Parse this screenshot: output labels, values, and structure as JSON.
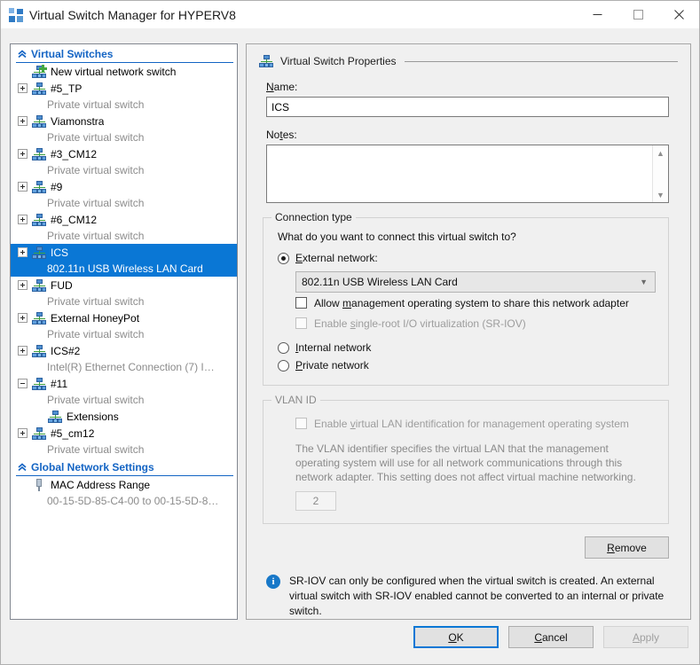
{
  "window": {
    "title": "Virtual Switch Manager for HYPERV8",
    "icon": "virtual-switch-manager-icon",
    "minimize_label": "–",
    "maximize_label": "□",
    "close_label": "✕"
  },
  "tree": {
    "sections": [
      {
        "id": "virtual-switches",
        "label": "Virtual Switches",
        "chevron": "chevron-up-icon",
        "items": [
          {
            "label": "New virtual network switch",
            "sub": "",
            "icon": "new-virtual-switch-icon",
            "expander": "none",
            "selected": false,
            "indent": 0
          },
          {
            "label": "#5_TP",
            "sub": "Private virtual switch",
            "icon": "virtual-switch-icon",
            "expander": "plus",
            "selected": false,
            "indent": 0
          },
          {
            "label": "Viamonstra",
            "sub": "Private virtual switch",
            "icon": "virtual-switch-icon",
            "expander": "plus",
            "selected": false,
            "indent": 0
          },
          {
            "label": "#3_CM12",
            "sub": "Private virtual switch",
            "icon": "virtual-switch-icon",
            "expander": "plus",
            "selected": false,
            "indent": 0
          },
          {
            "label": "#9",
            "sub": "Private virtual switch",
            "icon": "virtual-switch-icon",
            "expander": "plus",
            "selected": false,
            "indent": 0
          },
          {
            "label": "#6_CM12",
            "sub": "Private virtual switch",
            "icon": "virtual-switch-icon",
            "expander": "plus",
            "selected": false,
            "indent": 0
          },
          {
            "label": "ICS",
            "sub": "802.11n USB Wireless LAN Card",
            "icon": "virtual-switch-icon",
            "expander": "plus",
            "selected": true,
            "indent": 0
          },
          {
            "label": "FUD",
            "sub": "Private virtual switch",
            "icon": "virtual-switch-icon",
            "expander": "plus",
            "selected": false,
            "indent": 0
          },
          {
            "label": "External HoneyPot",
            "sub": "Private virtual switch",
            "icon": "virtual-switch-icon",
            "expander": "plus",
            "selected": false,
            "indent": 0
          },
          {
            "label": "ICS#2",
            "sub": "Intel(R) Ethernet Connection (7) I…",
            "icon": "virtual-switch-icon",
            "expander": "plus",
            "selected": false,
            "indent": 0
          },
          {
            "label": "#11",
            "sub": "Private virtual switch",
            "icon": "virtual-switch-icon",
            "expander": "minus",
            "selected": false,
            "indent": 0
          },
          {
            "label": "Extensions",
            "sub": "",
            "icon": "virtual-switch-icon",
            "expander": "none",
            "selected": false,
            "indent": 1
          },
          {
            "label": "#5_cm12",
            "sub": "Private virtual switch",
            "icon": "virtual-switch-icon",
            "expander": "plus",
            "selected": false,
            "indent": 0
          }
        ]
      },
      {
        "id": "global-network-settings",
        "label": "Global Network Settings",
        "chevron": "chevron-up-icon",
        "items": [
          {
            "label": "MAC Address Range",
            "sub": "00-15-5D-85-C4-00 to 00-15-5D-8…",
            "icon": "mac-address-range-icon",
            "expander": "none",
            "selected": false,
            "indent": 0
          }
        ]
      }
    ]
  },
  "properties": {
    "header": "Virtual Switch Properties",
    "header_icon": "virtual-switch-icon",
    "name_label": "Name:",
    "name_value": "ICS",
    "name_placeholder": "",
    "notes_label": "Notes:",
    "notes_value": "",
    "notes_placeholder": "",
    "connection": {
      "title": "Connection type",
      "question": "What do you want to connect this virtual switch to?",
      "external_label": "External network:",
      "external_selected": true,
      "adapter_value": "802.11n USB Wireless LAN Card",
      "allow_mgmt_label": "Allow management operating system to share this network adapter",
      "allow_mgmt_checked": false,
      "sriov_label": "Enable single-root I/O virtualization (SR-IOV)",
      "sriov_checked": false,
      "sriov_disabled": true,
      "internal_label": "Internal network",
      "internal_selected": false,
      "private_label": "Private network",
      "private_selected": false
    },
    "vlan": {
      "title": "VLAN ID",
      "enable_label": "Enable virtual LAN identification for management operating system",
      "enable_checked": false,
      "description": "The VLAN identifier specifies the virtual LAN that the management operating system will use for all network communications through this network adapter. This setting does not affect virtual machine networking.",
      "id_value": "2",
      "disabled": true
    },
    "remove_label": "Remove",
    "info_icon": "information-icon",
    "info_text": "SR-IOV can only be configured when the virtual switch is created. An external virtual switch with SR-IOV enabled cannot be converted to an internal or private switch."
  },
  "footer": {
    "ok_label": "OK",
    "cancel_label": "Cancel",
    "apply_label": "Apply",
    "apply_disabled": true
  },
  "colors": {
    "accent": "#0a77d5",
    "section_header": "#1364c4",
    "window_bg": "#f0f0f0",
    "info_blue": "#1878c8"
  }
}
